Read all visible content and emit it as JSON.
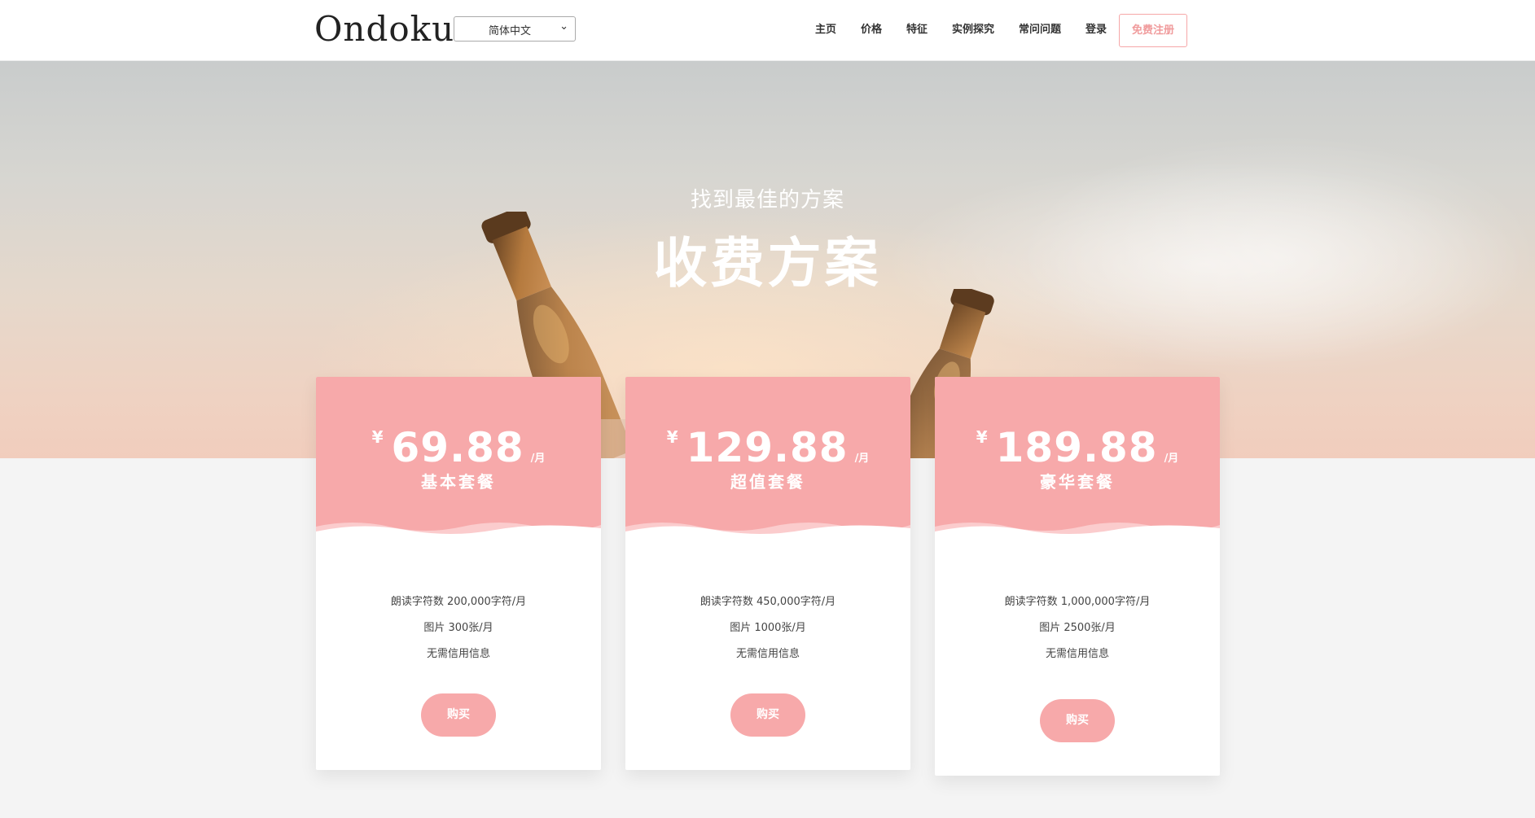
{
  "header": {
    "logo": "Ondoku",
    "language": {
      "selected": "简体中文"
    },
    "nav": [
      {
        "label": "主页"
      },
      {
        "label": "价格"
      },
      {
        "label": "特征"
      },
      {
        "label": "实例探究"
      },
      {
        "label": "常问问题"
      },
      {
        "label": "登录"
      }
    ],
    "signup_label": "免费注册"
  },
  "hero": {
    "subtitle": "找到最佳的方案",
    "title": "收费方案"
  },
  "plans": [
    {
      "currency": "¥",
      "price": "69.88",
      "period": "/月",
      "name": "基本套餐",
      "features": [
        "朗读字符数 200,000字符/月",
        "图片 300张/月",
        "无需信用信息"
      ],
      "button": "购买"
    },
    {
      "currency": "¥",
      "price": "129.88",
      "period": "/月",
      "name": "超值套餐",
      "features": [
        "朗读字符数 450,000字符/月",
        "图片 1000张/月",
        "无需信用信息"
      ],
      "button": "购买"
    },
    {
      "currency": "¥",
      "price": "189.88",
      "period": "/月",
      "name": "豪华套餐",
      "features": [
        "朗读字符数 1,000,000字符/月",
        "图片 2500张/月",
        "无需信用信息"
      ],
      "button": "购买"
    }
  ],
  "colors": {
    "accent": "#f7a9aa",
    "accent_text": "#f09b9c",
    "background": "#f4f4f4"
  }
}
